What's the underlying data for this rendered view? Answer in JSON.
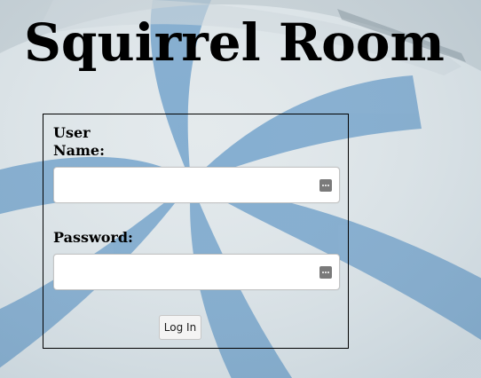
{
  "page": {
    "title": "Squirrel Room"
  },
  "login_form": {
    "username_label": "User Name:",
    "username_value": "",
    "password_label": "Password:",
    "password_value": "",
    "submit_label": "Log In",
    "field_icon": "password-manager-key-icon"
  },
  "background": {
    "description_colors": {
      "stripe_blue": "#5f95c3",
      "stripe_light": "#e6ebec"
    }
  }
}
